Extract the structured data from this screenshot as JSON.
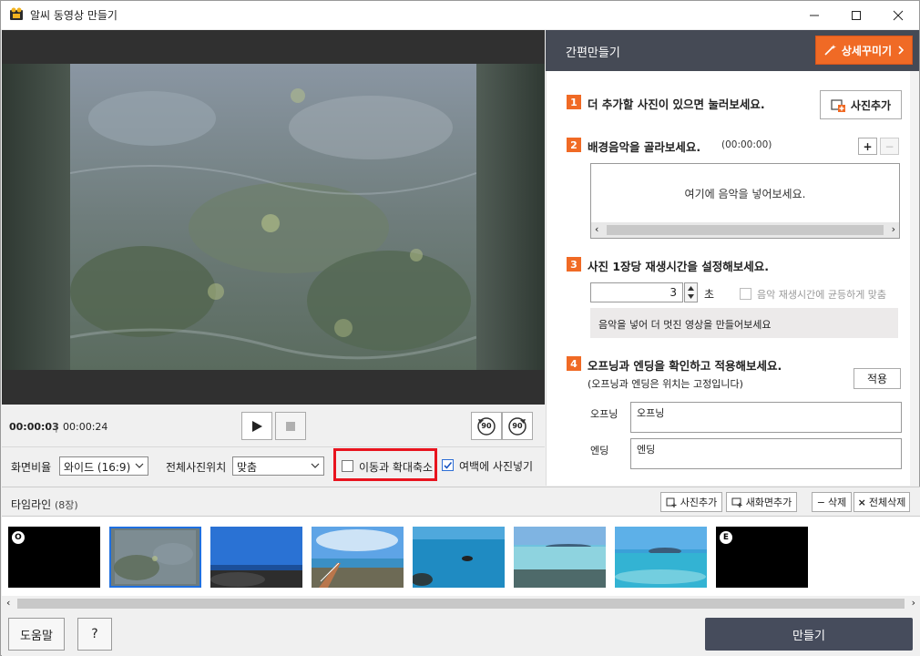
{
  "window": {
    "title": "알씨 동영상 만들기"
  },
  "player": {
    "current_time": "00:00:03",
    "separator": "|",
    "total_time": "00:00:24",
    "rotate_left_label": "90",
    "rotate_right_label": "90"
  },
  "options": {
    "aspect_label": "화면비율",
    "aspect_value": "와이드 (16:9)",
    "position_label": "전체사진위치",
    "position_value": "맞춤",
    "pan_zoom_label": "이동과 확대축소",
    "pan_zoom_checked": false,
    "fill_margin_label": "여백에 사진넣기",
    "fill_margin_checked": true
  },
  "panel": {
    "title": "간편만들기",
    "detail_button": "상세꾸미기",
    "step1": {
      "num": "1",
      "text": "더 추가할 사진이 있으면 눌러보세요.",
      "button": "사진추가"
    },
    "step2": {
      "num": "2",
      "text": "배경음악을 골라보세요.",
      "duration": "(00:00:00)",
      "add": "+",
      "remove": "−",
      "placeholder": "여기에 음악을 넣어보세요."
    },
    "step3": {
      "num": "3",
      "text": "사진 1장당 재생시간을 설정해보세요.",
      "seconds": "3",
      "unit": "초",
      "fit_label": "음악 재생시간에 균등하게 맞춤",
      "hint": "음악을 넣어 더 멋진 영상을 만들어보세요"
    },
    "step4": {
      "num": "4",
      "text": "오프닝과 엔딩을 확인하고 적용해보세요.",
      "note": "(오프닝과 엔딩은 위치는 고정입니다)",
      "apply": "적용",
      "opening_label": "오프닝",
      "opening_value": "오프닝",
      "ending_label": "엔딩",
      "ending_value": "엔딩"
    }
  },
  "timeline": {
    "title": "타임라인",
    "count": "(8장)",
    "add_photo": "사진추가",
    "add_screen": "새화면추가",
    "delete": "삭제",
    "delete_all": "전체삭제",
    "items": [
      {
        "badge": "O",
        "kind": "opening"
      },
      {
        "badge": "",
        "kind": "underwater",
        "selected": true
      },
      {
        "badge": "",
        "kind": "sky-rocks"
      },
      {
        "badge": "",
        "kind": "boardwalk"
      },
      {
        "badge": "",
        "kind": "sea-rock"
      },
      {
        "badge": "",
        "kind": "shallow-sea"
      },
      {
        "badge": "",
        "kind": "sea-island"
      },
      {
        "badge": "E",
        "kind": "ending"
      }
    ]
  },
  "footer": {
    "help": "도움말",
    "question": "?",
    "make": "만들기"
  },
  "colors": {
    "accent": "#f06a25",
    "panel_header": "#454a55",
    "make_button": "#464c5c",
    "highlight": "#e8141e"
  }
}
